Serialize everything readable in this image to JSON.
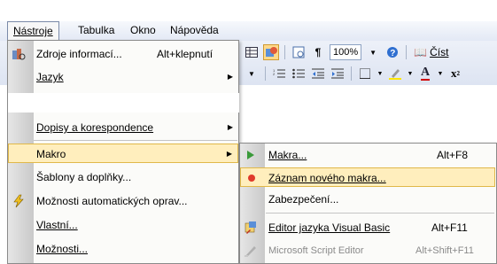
{
  "menubar": {
    "items": [
      {
        "label": "Nástroje"
      },
      {
        "label": "Tabulka"
      },
      {
        "label": "Okno"
      },
      {
        "label": "Nápověda"
      }
    ]
  },
  "toolbar": {
    "zoom": "100%",
    "read_label": "Číst",
    "pilcrow": "¶"
  },
  "tools_menu": {
    "items": [
      {
        "label": "Zdroje informací...",
        "shortcut": "Alt+klepnutí",
        "icon": "research-books-icon"
      },
      {
        "label": "Jazyk",
        "submenu": true
      },
      {
        "label": "Dopisy a korespondence",
        "submenu": true
      },
      {
        "label": "Makro",
        "submenu": true,
        "highlighted": true
      },
      {
        "label": "Šablony a doplňky..."
      },
      {
        "label": "Možnosti automatických oprav...",
        "icon": "autocorrect-lightning-icon"
      },
      {
        "label": "Vlastní..."
      },
      {
        "label": "Možnosti..."
      }
    ]
  },
  "macro_menu": {
    "items": [
      {
        "label": "Makra...",
        "shortcut": "Alt+F8",
        "icon": "play-triangle-icon"
      },
      {
        "label": "Záznam nového makra...",
        "icon": "record-dot-icon",
        "highlighted": true
      },
      {
        "label": "Zabezpečení..."
      },
      {
        "label": "Editor jazyka Visual Basic",
        "shortcut": "Alt+F11",
        "icon": "visual-basic-editor-icon"
      },
      {
        "label": "Microsoft Script Editor",
        "shortcut": "Alt+Shift+F11",
        "icon": "script-editor-icon",
        "disabled": true
      }
    ]
  },
  "colors": {
    "highlight_bg": "#ffeebd",
    "highlight_border": "#e0b84a",
    "menu_bg": "#fbfbf9",
    "toolbar_bg": "#dde4f2"
  }
}
